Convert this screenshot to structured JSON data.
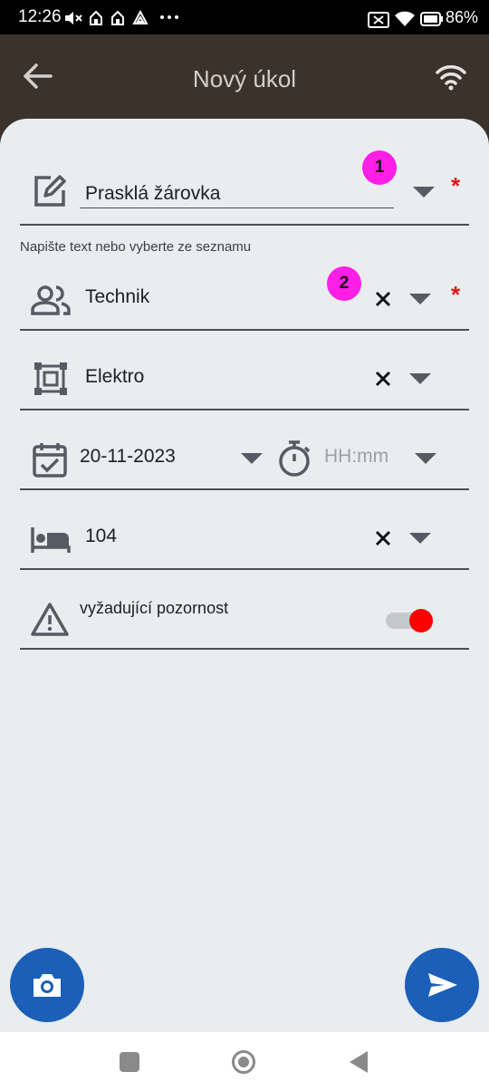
{
  "status_bar": {
    "time": "12:26",
    "battery": "86%"
  },
  "app_bar": {
    "title": "Nový úkol"
  },
  "fields": {
    "task_name": {
      "value": "Prasklá žárovka",
      "badge": "1",
      "helper": "Napište text nebo vyberte ze seznamu"
    },
    "role": {
      "value": "Technik",
      "badge": "2"
    },
    "category": {
      "value": "Elektro"
    },
    "date": {
      "value": "20-11-2023"
    },
    "time": {
      "placeholder": "HH:mm"
    },
    "room": {
      "value": "104"
    },
    "attention": {
      "label": "vyžadující pozornost",
      "enabled": true
    }
  },
  "required_mark": "*",
  "colors": {
    "accent": "#1b5fb8",
    "badge": "#ff1ee6",
    "required": "#e01818",
    "toggle_on": "#ff0000",
    "app_bar": "#3b322c"
  }
}
